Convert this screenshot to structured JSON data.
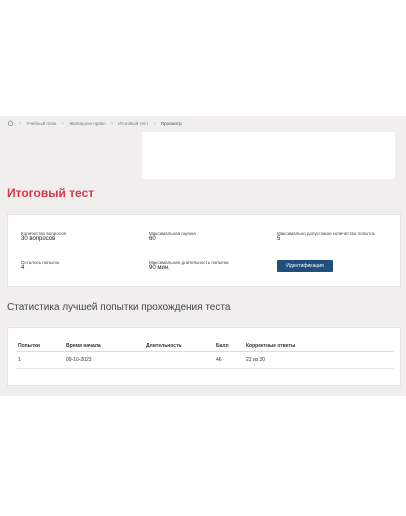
{
  "breadcrumb": {
    "items": [
      "Учебный план",
      "Жилищное право",
      "Итоговый тест"
    ],
    "current": "Просмотр"
  },
  "page": {
    "title": "Итоговый тест"
  },
  "test_info": {
    "questions_label": "Количество вопросов",
    "questions_value": "30 вопросов",
    "max_score_label": "Максимальная оценка",
    "max_score_value": "60",
    "max_attempts_label": "Максимально допустимое количество попыток",
    "max_attempts_value": "5",
    "remaining_label": "Осталось попыток",
    "remaining_value": "4",
    "duration_label": "Максимальная длительность попытки",
    "duration_value": "90 мин.",
    "identify_button": "Идентификация"
  },
  "stats": {
    "title": "Статистика лучшей попытки прохождения теста",
    "columns": [
      "Попытки",
      "Время начала",
      "Длительность",
      "Балл",
      "Корректные ответы"
    ],
    "rows": [
      [
        "1",
        "09-10-2023",
        "",
        "46",
        "23 из 30"
      ]
    ]
  }
}
